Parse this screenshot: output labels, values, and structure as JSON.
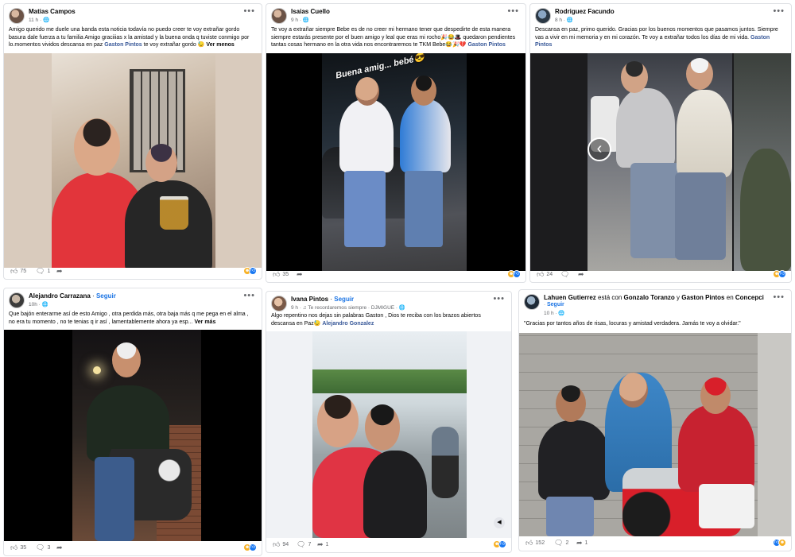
{
  "posts": [
    {
      "author": "Matias Campos",
      "meta": "11 h · 🌐",
      "text": "Amigo querido me duele una banda esta noticia todavía no puedo creer te voy extrañar gordo basura dale fuerza a tu familia Amigo graciiias x la amistad y la buena onda q tuviste conmigo por lo.momentos vividos descansa en paz",
      "tag": "Gaston Pintos",
      "text_after": " te voy extrañar gordo 😓",
      "more": "Ver menos",
      "likes": "75",
      "comments": "1",
      "shares": ""
    },
    {
      "author": "Isaias Cuello",
      "meta": "9 h · 🌐",
      "text": "Te voy a extrañar siempre Bebe es de no creer mi hermano tener que despedirte de esta manera siempre estarás presente por el buen amigo y leal que eras mi rocho🎉😂🎩 quedaron pendientes tantas cosas hermano en la otra vida nos encontraremos te TKM Bebe😂🎉💔",
      "tag": "Gaston Pintos",
      "text_after": "",
      "more": "",
      "overlay": "Buena amig... bebé😎",
      "likes": "35",
      "comments": "",
      "shares": ""
    },
    {
      "author": "Rodriguez Facundo",
      "meta": "8 h · 🌐",
      "text": "Descansa en paz, primo querido. Gracias por los buenos momentos que pasamos juntos. Siempre vas a vivir en mi memoria y en mi corazón. Te voy a extrañar todos los días de mi vida.",
      "tag": "Gaston Pintos",
      "text_after": "",
      "more": "",
      "likes": "24",
      "comments": "",
      "shares": ""
    },
    {
      "author": "Alejandro Carrazana",
      "follow": "Seguir",
      "meta": "10h · 🌐",
      "text": "Que bajón enterarme así de esto Amigo , otra perdida más,  otra baja más q me pega en el alma , no era tu momento , no te tenias q ir así , lamentablemente ahora ya esp...",
      "tag": "",
      "text_after": "",
      "more": "Ver más",
      "likes": "35",
      "comments": "3",
      "shares": ""
    },
    {
      "author": "Ivana Pintos",
      "follow": "Seguir",
      "meta": "9 h · ♫ Te recordaremos siempre · DJMIGUE · 🌐",
      "text": "Algo repentino nos dejas sin palabras Gaston , Dios te reciba con los brazos abiertos descansa en Paz😓",
      "tag": "Alejandro Gonzalez",
      "text_after": "",
      "more": "",
      "likes": "94",
      "comments": "7",
      "shares": "1"
    },
    {
      "author": "Lahuen Gutierrez",
      "with_text": "está con",
      "with1": "Gonzalo Toranzo",
      "and_text": "y",
      "with2": "Gaston Pintos",
      "in_text": "en",
      "place": "Concepción",
      "follow": "Seguir",
      "meta": "10 h · 🌐",
      "text": "\"Gracias por tantos años de risas, locuras y amistad verdadera. Jamás te voy a olvidar.\"",
      "tag": "",
      "text_after": "",
      "more": "",
      "likes": "152",
      "comments": "2",
      "shares": "1"
    }
  ],
  "icons": {
    "more": "more-options-icon",
    "like": "like-icon",
    "comment": "comment-icon",
    "share": "share-icon",
    "prev": "chevron-left-icon",
    "mute": "mute-icon"
  },
  "colors": {
    "link": "#385898",
    "follow": "#1b74e4",
    "meta": "#65676b",
    "like_reaction": "#1877f2",
    "haha_reaction": "#f7b125"
  }
}
